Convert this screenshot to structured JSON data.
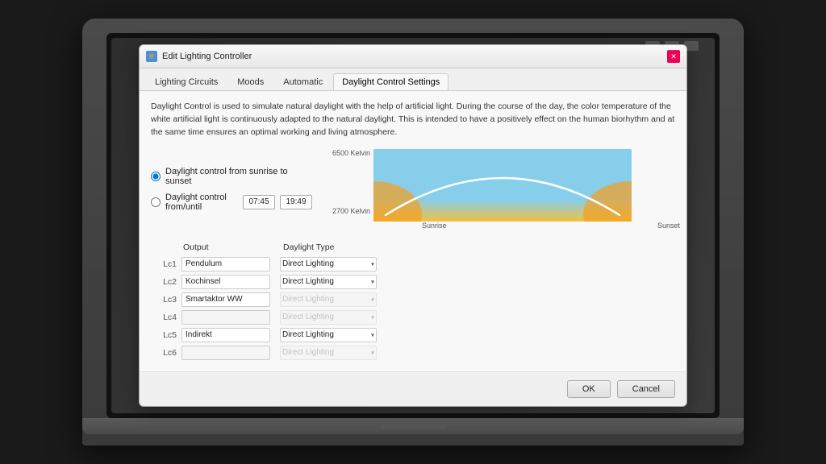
{
  "dialog": {
    "title": "Edit Lighting Controller",
    "tabs": [
      "Lighting Circuits",
      "Moods",
      "Automatic",
      "Daylight Control Settings"
    ],
    "active_tab": "Daylight Control Settings",
    "description": "Daylight Control is used to simulate natural daylight with the help of artificial light. During the course of the day, the color temperature of the white artificial light is continuously adapted to the natural daylight. This is intended to have a positively effect on the human biorhythm and at the same time ensures an optimal working and living atmosphere.",
    "radio1_label": "Daylight control from sunrise to sunset",
    "radio2_label": "Daylight control from/until",
    "radio1_selected": true,
    "radio2_selected": false,
    "time_from": "07:45",
    "time_until": "19:49",
    "chart": {
      "y_top": "6500 Kelvin",
      "y_bottom": "2700 Kelvin",
      "x_left": "Sunrise",
      "x_right": "Sunset"
    },
    "table": {
      "col_output": "Output",
      "col_daylight": "Daylight Type",
      "rows": [
        {
          "label": "Lc1",
          "output": "Pendulum",
          "daylight": "Direct Lighting",
          "enabled": true
        },
        {
          "label": "Lc2",
          "output": "Kochinsel",
          "daylight": "Direct Lighting",
          "enabled": true
        },
        {
          "label": "Lc3",
          "output": "Smartaktor WW",
          "daylight": "Direct Lighting",
          "enabled": false
        },
        {
          "label": "Lc4",
          "output": "",
          "daylight": "Direct Lighting",
          "enabled": false
        },
        {
          "label": "Lc5",
          "output": "Indirekt",
          "daylight": "Direct Lighting",
          "enabled": true
        },
        {
          "label": "Lc6",
          "output": "",
          "daylight": "Direct Lighting",
          "enabled": false
        }
      ]
    },
    "buttons": {
      "ok": "OK",
      "cancel": "Cancel"
    }
  }
}
